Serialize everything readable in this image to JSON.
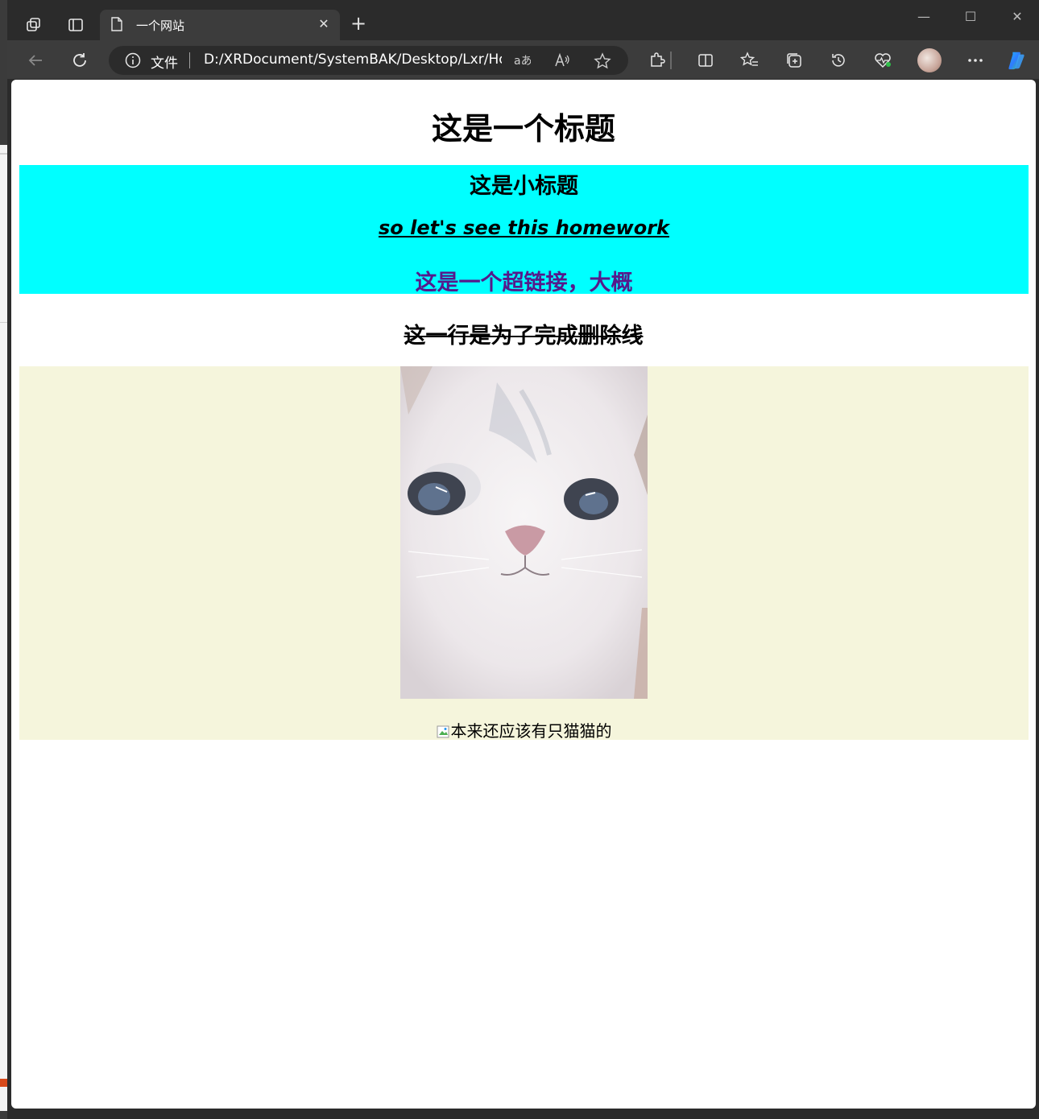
{
  "browser": {
    "tab_title": "一个网站",
    "address_label": "文件",
    "address_url": "D:/XRDocument/SystemBAK/Desktop/Lxr/Ho..."
  },
  "page": {
    "title": "这是一个标题",
    "subtitle": "这是小标题",
    "italic_text": "so let's see this homework",
    "link_text": "这是一个超链接，大概",
    "strike_text": "这一行是为了完成删除线",
    "broken_image_alt": "本来还应该有只猫猫的"
  },
  "colors": {
    "cyan_block": "#00ffff",
    "beige_block": "#f5f5dc",
    "visited_link": "#551a8b"
  }
}
